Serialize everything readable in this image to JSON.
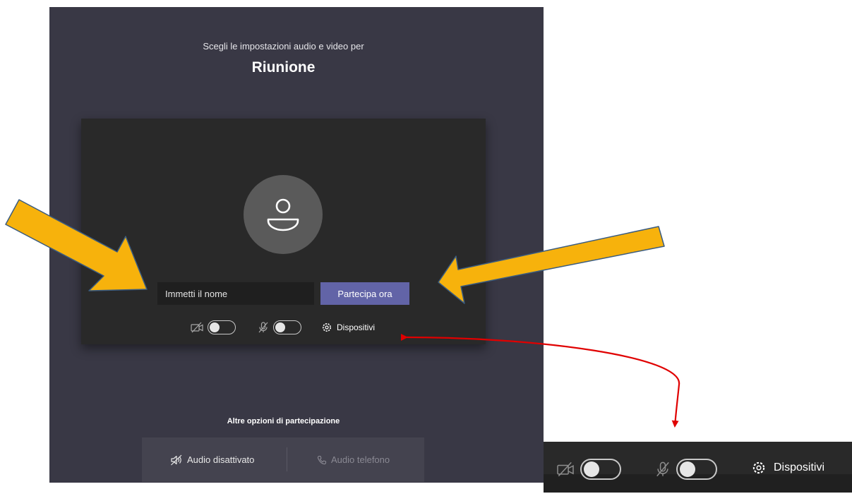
{
  "prejoin": {
    "subtitle": "Scegli le impostazioni audio e video per",
    "meeting_title": "Riunione",
    "name_input": {
      "placeholder": "Immetti il nome",
      "value": ""
    },
    "join_button_label": "Partecipa ora",
    "controls": {
      "camera_icon": "camera-off-icon",
      "camera_toggle_on": false,
      "mic_icon": "mic-off-icon",
      "mic_toggle_on": false,
      "devices_icon": "gear-icon",
      "devices_label": "Dispositivi"
    },
    "other_options": {
      "title": "Altre opzioni di partecipazione",
      "audio_off_label": "Audio disattivato",
      "audio_off_icon": "speaker-off-icon",
      "phone_audio_label": "Audio telefono",
      "phone_audio_icon": "phone-icon"
    }
  },
  "zoomed_controls": {
    "devices_label": "Dispositivi"
  },
  "annotation_colors": {
    "arrow_fill": "#f7b20c",
    "arrow_outline": "#3b5c80",
    "connector": "#e00000"
  },
  "theme": {
    "panel_bg": "#393845",
    "card_bg": "#292929",
    "accent": "#6264a7"
  }
}
